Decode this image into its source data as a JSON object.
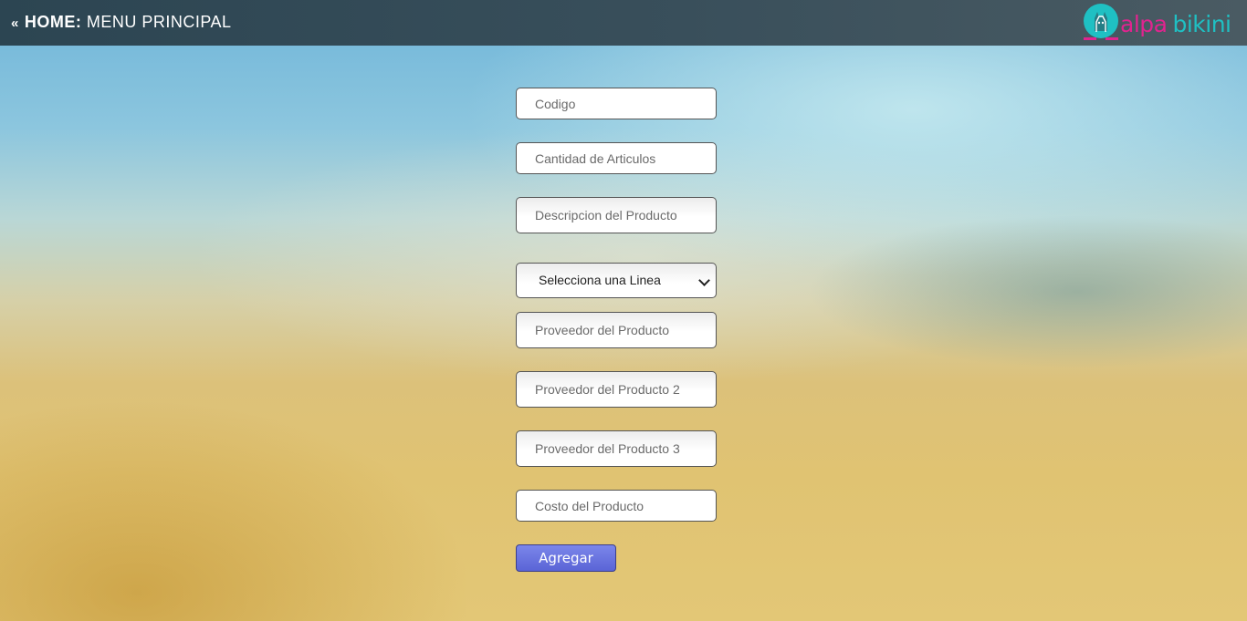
{
  "header": {
    "back_chevron": "«",
    "home_label": "HOME:",
    "menu_label": "MENU PRINCIPAL",
    "logo": {
      "word1": "alpa",
      "word2": "bikini",
      "pink": "#e0248f",
      "teal": "#1fc0c3"
    }
  },
  "form": {
    "codigo_placeholder": "Codigo",
    "cantidad_placeholder": "Cantidad de Articulos",
    "descripcion_placeholder": "Descripcion del Producto",
    "linea_select_value": "Selecciona una Linea",
    "proveedor1_placeholder": "Proveedor del Producto",
    "proveedor2_placeholder": "Proveedor del Producto 2",
    "proveedor3_placeholder": "Proveedor del Producto 3",
    "costo_placeholder": "Costo del Producto",
    "submit_label": "Agregar"
  },
  "colors": {
    "topbar": "#2c4552",
    "button": "#5a64d6"
  }
}
